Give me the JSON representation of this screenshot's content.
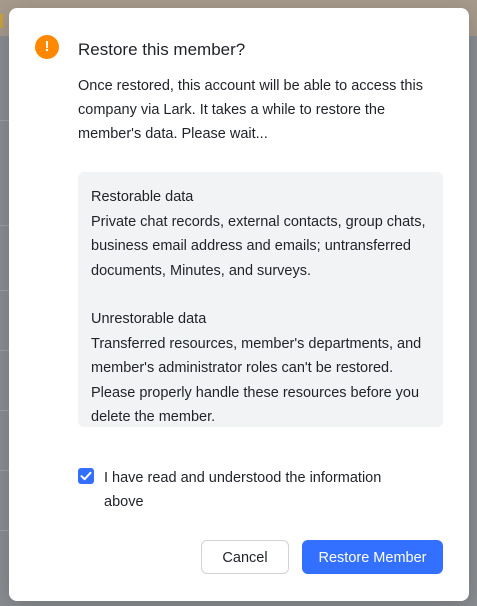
{
  "dialog": {
    "title": "Restore this member?",
    "icon": "warning-icon",
    "intro": "Once restored, this account will be able to access this company via Lark. It takes a while to restore the member's data. Please wait...",
    "info": {
      "restorable_heading": "Restorable data",
      "restorable_body": "Private chat records, external contacts, group chats, business email address and emails; untransferred documents, Minutes, and surveys.",
      "unrestorable_heading": "Unrestorable data",
      "unrestorable_body": "Transferred resources, member's departments, and member's administrator roles can't be restored. Please properly handle these resources before you delete the member."
    },
    "confirm": {
      "checked": true,
      "label": "I have read and understood the information above"
    },
    "buttons": {
      "cancel": "Cancel",
      "restore": "Restore Member"
    }
  },
  "colors": {
    "accent": "#3370ff",
    "warning": "#ff8800",
    "info_background": "#f2f3f5"
  }
}
